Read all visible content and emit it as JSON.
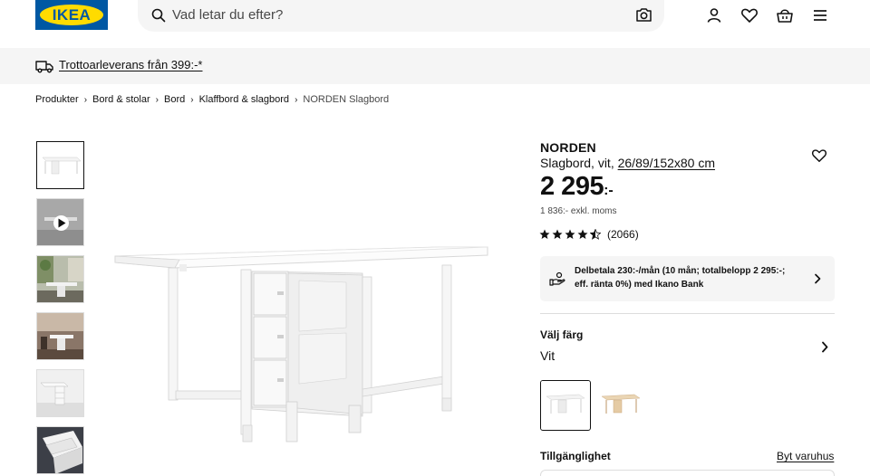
{
  "header": {
    "logo_text": "IKEA",
    "search_placeholder": "Vad letar du efter?",
    "icons": [
      "search-icon",
      "camera-icon",
      "account-icon",
      "heart-icon",
      "basket-icon",
      "menu-icon"
    ]
  },
  "delivery": {
    "text": "Trottoarleverans från 399:-*"
  },
  "breadcrumb": [
    "Produkter",
    "Bord & stolar",
    "Bord",
    "Klaffbord & slagbord",
    "NORDEN Slagbord"
  ],
  "product": {
    "name": "NORDEN",
    "desc_prefix": "Slagbord, vit, ",
    "dimensions": "26/89/152x80 cm",
    "price_main": "2 295",
    "price_suffix": ":-",
    "price_ex_vat": "1 836:- exkl. moms",
    "rating_stars": 4.5,
    "rating_count": "(2066)"
  },
  "financing": {
    "text": "Delbetala 230:-/mån (10 mån; totalbelopp 2 295:-; eff. ränta 0%) med Ikano Bank"
  },
  "color": {
    "label": "Välj färg",
    "value": "Vit"
  },
  "availability": {
    "label": "Tillgänglighet",
    "change_store": "Byt varuhus"
  },
  "colors": {
    "ikea_blue": "#0058a3",
    "ikea_yellow": "#ffdb00",
    "light_gray": "#f5f5f5"
  }
}
